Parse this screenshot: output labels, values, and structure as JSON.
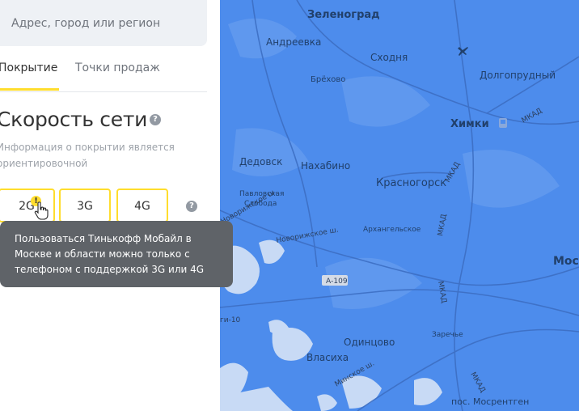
{
  "search": {
    "placeholder": "Адрес, город или регион"
  },
  "tabs": [
    {
      "label": "Покрытие",
      "active": true
    },
    {
      "label": "Точки продаж",
      "active": false
    }
  ],
  "section": {
    "title": "Скорость сети",
    "info": "Информация о покрытии является ориентировочной"
  },
  "generations": [
    "2G",
    "3G",
    "4G"
  ],
  "warning_icon": "!",
  "help_icon": "?",
  "tooltip": {
    "text": "Пользоваться Тинькофф Мобайл в Москве и области можно только с телефоном с поддержкой 3G или 4G"
  },
  "map": {
    "cities": {
      "zelenograd": "Зеленоград",
      "andreevka": "Андреевка",
      "skhodnya": "Сходня",
      "dolgoprudny": "Долгопрудный",
      "brekhovo": "Брёхово",
      "khimki": "Химки",
      "dedovsk": "Дедовск",
      "nakhabino": "Нахабино",
      "krasnogorsk": "Красногорск",
      "pavlovskaya1": "Павловская",
      "pavlovskaya2": "Слобода",
      "arkhangelskoe": "Архангельское",
      "odintsovo": "Одинцово",
      "zarechye": "Заречье",
      "vlasikha": "Власиха",
      "mosrentgen": "пос. Мосрентген",
      "moscow": "Мос"
    },
    "roads": {
      "mkad": "МКАД",
      "novorizhskoe": "Новорижское ш.",
      "a109": "А-109",
      "minskoe": "Минское ш.",
      "rizh10": "ги-10"
    }
  },
  "colors": {
    "accent": "#ffdd2d",
    "map_coverage": "#4d8cec",
    "tooltip_bg": "#5f6368"
  }
}
